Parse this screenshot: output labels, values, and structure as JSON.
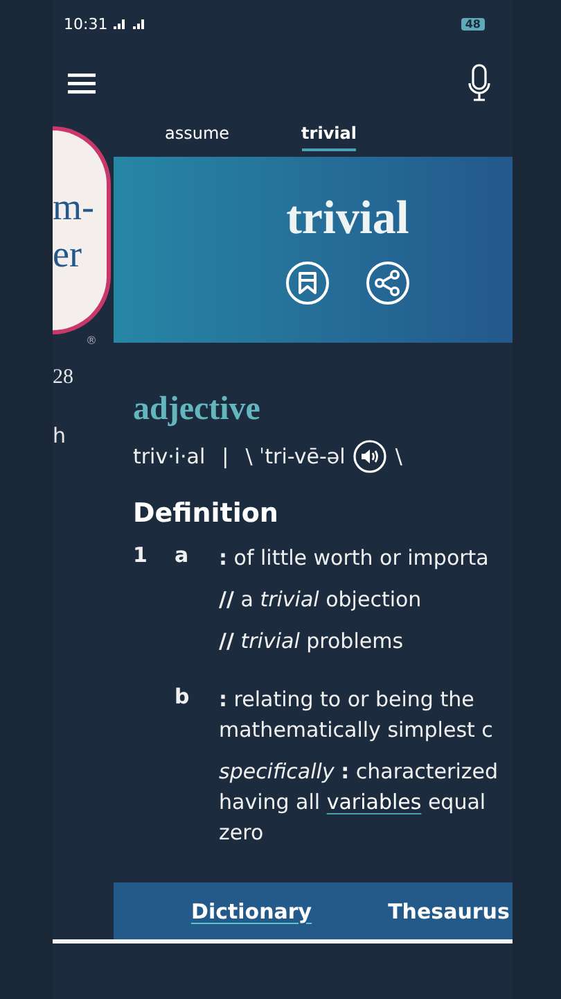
{
  "status_bar": {
    "time": "10:31",
    "battery": "48"
  },
  "drawer": {
    "logo_lines": [
      "m-",
      "er"
    ],
    "logo_mark": "®",
    "items": [
      "28",
      "h"
    ]
  },
  "tabs": [
    {
      "label": "assume",
      "selected": false
    },
    {
      "label": "trivial",
      "selected": true
    }
  ],
  "headword": "trivial",
  "part_of_speech": "adjective",
  "pronunciation": {
    "syllables": "triv·i·al",
    "separator": "|",
    "text": "\\ ˈtri-vē-əl",
    "end": "\\"
  },
  "section_title": "Definition",
  "senses": [
    {
      "number": "1",
      "letter": "a",
      "paragraphs": [
        [
          {
            "text": "**:** of little worth or importa"
          }
        ],
        [
          {
            "text": "**//** a *trivial* objection"
          }
        ],
        [
          {
            "text": "**//** *trivial* problems"
          }
        ]
      ]
    },
    {
      "letter": "b",
      "paragraphs": [
        [
          {
            "text": "**:** relating to or being the"
          },
          {
            "text": "mathematically simplest c"
          }
        ],
        [
          {
            "text": "*specifically* **:** characterized"
          },
          {
            "text": "having all ",
            "link": "variables",
            "after": " equal"
          },
          {
            "text": "zero"
          }
        ]
      ]
    }
  ],
  "bottom_tabs": [
    {
      "label": "Dictionary",
      "selected": true
    },
    {
      "label": "Thesaurus",
      "selected": false
    }
  ]
}
